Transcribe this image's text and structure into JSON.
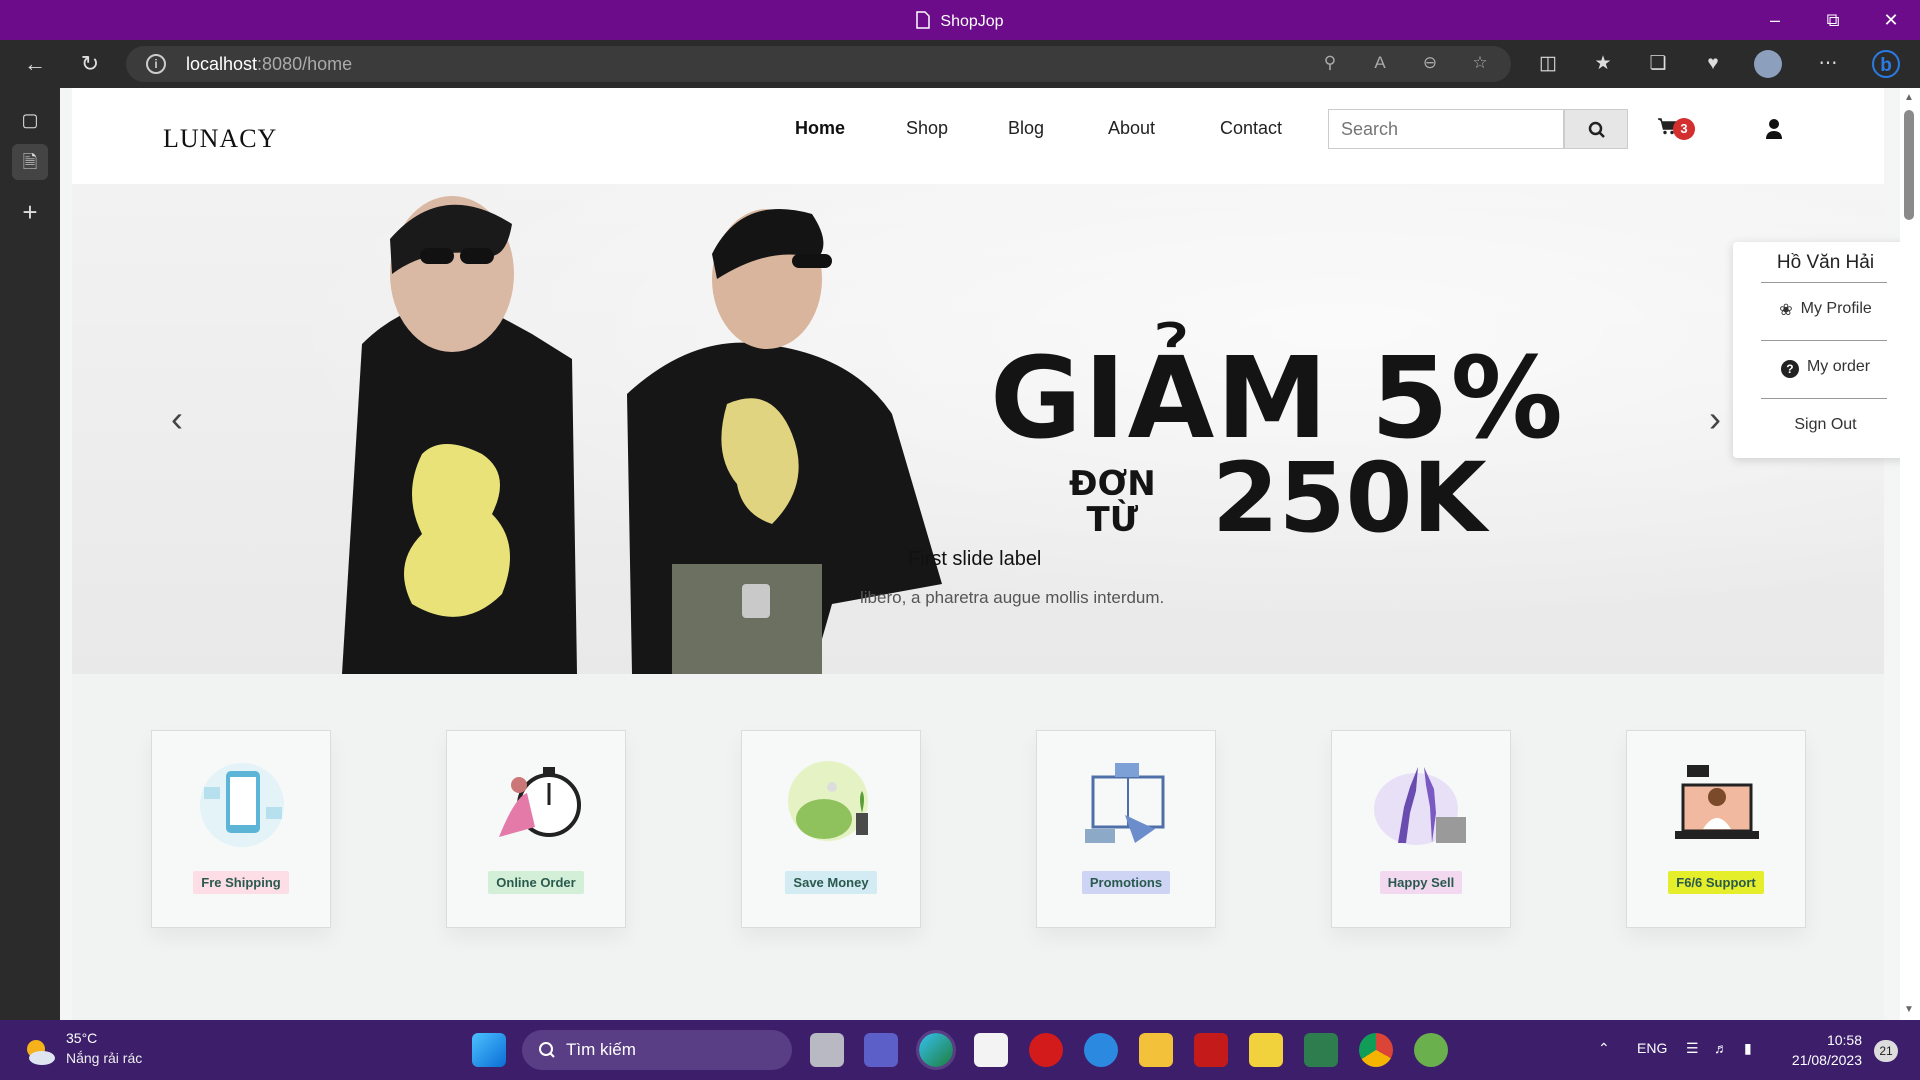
{
  "window": {
    "title": "ShopJop"
  },
  "browser": {
    "url_host": "localhost",
    "url_rest": ":8080/home"
  },
  "site": {
    "logo": "LUNACY",
    "menu": [
      "Home",
      "Shop",
      "Blog",
      "About",
      "Contact"
    ],
    "active_menu": "Home",
    "search_placeholder": "Search",
    "cart_count": "3"
  },
  "user_menu": {
    "name": "Hồ Văn Hải",
    "items": [
      "My Profile",
      "My order",
      "Sign Out"
    ]
  },
  "hero": {
    "headline1": "GIẢM 5%",
    "headline2_top": "ĐƠN",
    "headline2_bottom": "TỪ",
    "headline2_big": "250K",
    "caption_title": "First slide label",
    "caption_text": "libero, a pharetra augue mollis interdum."
  },
  "features": [
    {
      "label": "Fre Shipping",
      "color": "#fddde6"
    },
    {
      "label": "Online Order",
      "color": "#d4efd8"
    },
    {
      "label": "Save Money",
      "color": "#d3ebf3"
    },
    {
      "label": "Promotions",
      "color": "#cdd4f4"
    },
    {
      "label": "Happy Sell",
      "color": "#f2d9ef"
    },
    {
      "label": "F6/6 Support",
      "color": "#e4ee2a"
    }
  ],
  "taskbar": {
    "temperature": "35°C",
    "weather": "Nắng rải rác",
    "search": "Tìm kiếm",
    "language": "ENG",
    "time": "10:58",
    "date": "21/08/2023",
    "notifications": "21"
  },
  "colors": {
    "titlebar": "#6c0c8a",
    "taskbar": "#3c1e6b",
    "badge": "#d32f2f"
  }
}
